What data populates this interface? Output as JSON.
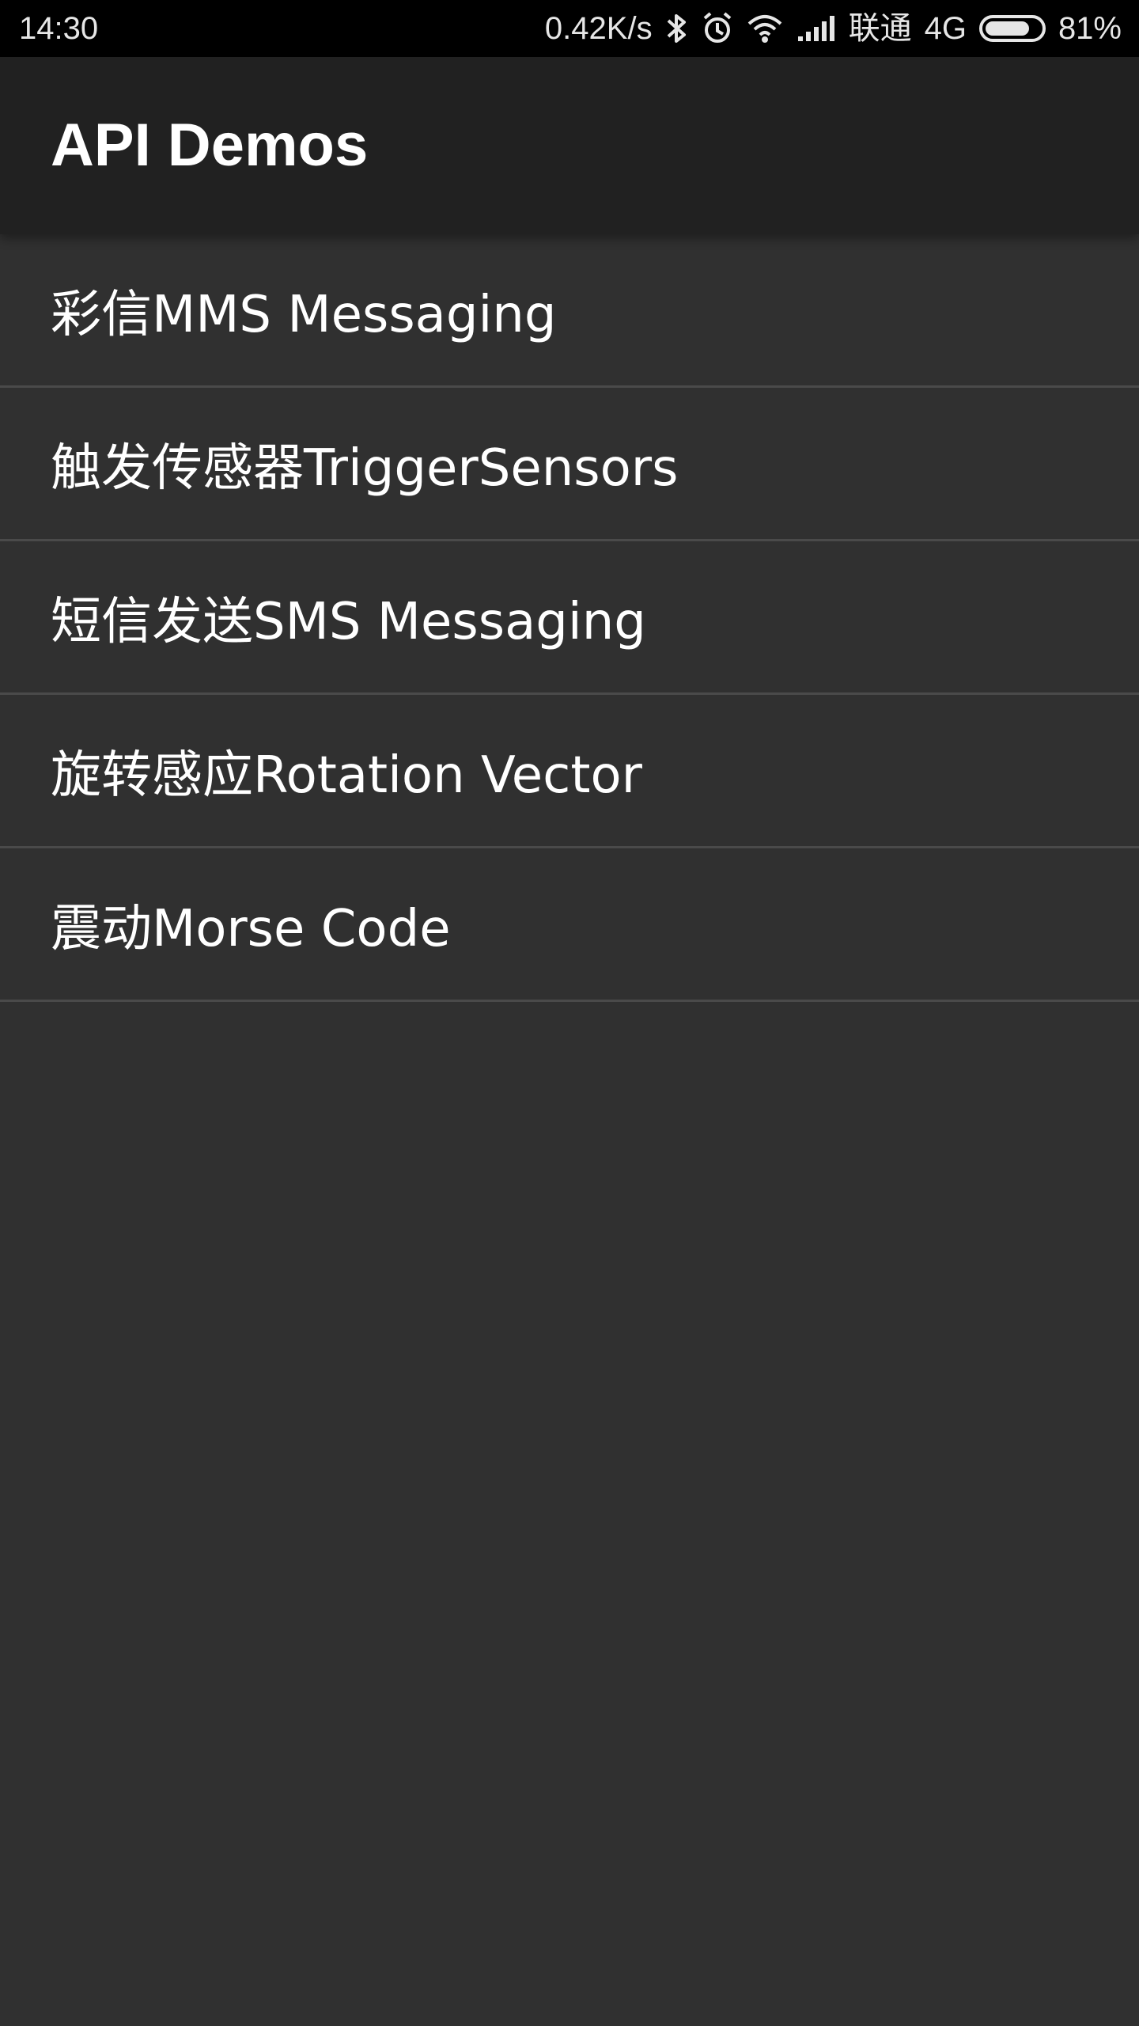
{
  "status_bar": {
    "time": "14:30",
    "network_speed": "0.42K/s",
    "carrier": "联通",
    "network_type": "4G",
    "battery_percent_label": "81%",
    "battery_level": 0.81,
    "icons": [
      "bluetooth-icon",
      "alarm-icon",
      "wifi-icon",
      "signal-icon",
      "battery-icon"
    ]
  },
  "app_bar": {
    "title": "API Demos"
  },
  "list": {
    "items": [
      {
        "label": "彩信MMS Messaging"
      },
      {
        "label": "触发传感器TriggerSensors"
      },
      {
        "label": "短信发送SMS Messaging"
      },
      {
        "label": "旋转感应Rotation Vector"
      },
      {
        "label": "震动Morse Code"
      }
    ]
  },
  "colors": {
    "status_bar_bg": "#000000",
    "app_bar_bg": "#212121",
    "content_bg": "#303030",
    "divider": "#4a4a4a",
    "text_primary": "#ffffff"
  }
}
